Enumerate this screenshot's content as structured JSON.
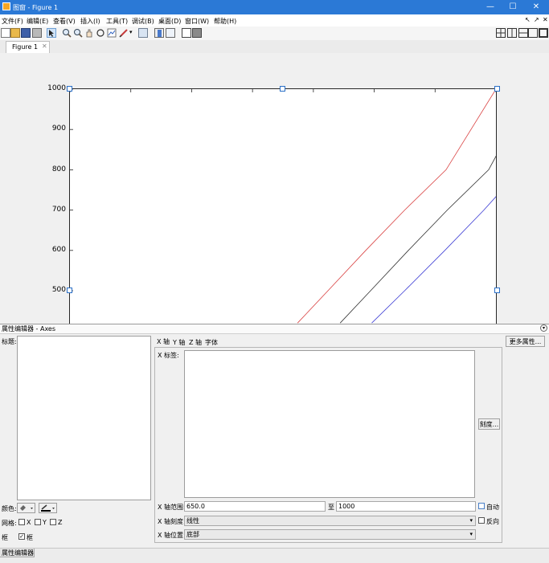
{
  "window": {
    "title": "图窗 - Figure 1"
  },
  "menu": [
    "文件(F)",
    "编辑(E)",
    "查看(V)",
    "插入(I)",
    "工具(T)",
    "调试(B)",
    "桌面(D)",
    "窗口(W)",
    "帮助(H)"
  ],
  "tabs": {
    "figure": "Figure 1"
  },
  "chart_data": {
    "type": "line",
    "yticks": [
      "1000",
      "900",
      "800",
      "700",
      "600",
      "500"
    ],
    "xlim": [
      650,
      1000
    ],
    "series": [
      {
        "color": "#d94040",
        "x": [
          837,
          862,
          893,
          925,
          959,
          1000
        ],
        "y": [
          420,
          500,
          600,
          700,
          800,
          1000
        ]
      },
      {
        "color": "#303030",
        "x": [
          872,
          897,
          928,
          960,
          994,
          1030
        ],
        "y": [
          420,
          500,
          600,
          700,
          800,
          1000
        ]
      },
      {
        "color": "#3b3bd4",
        "x": [
          898,
          925,
          958,
          990,
          1020,
          1057
        ],
        "y": [
          420,
          500,
          600,
          700,
          800,
          1000
        ]
      }
    ]
  },
  "property_editor": {
    "header": "属性编辑器 - Axes",
    "title_label": "标题:",
    "color_label": "颜色:",
    "grid_label": "网格:",
    "grid_x": "X",
    "grid_y": "Y",
    "grid_z": "Z",
    "box_label": "框",
    "box_checkbox_label": "框",
    "tabs": [
      "X 轴",
      "Y 轴",
      "Z 轴",
      "字体"
    ],
    "more_props": "更多属性...",
    "xlabel_label": "X 标签:",
    "ticks_button": "刻度...",
    "xlim_label": "X 轴范围:",
    "xlim_min": "650.0",
    "xlim_to": "至",
    "xlim_max": "1000",
    "auto_label": "自动",
    "xscale_label": "X 轴刻度:",
    "xscale_value": "线性",
    "reverse_label": "反向",
    "xloc_label": "X 轴位置:",
    "xloc_value": "底部"
  },
  "status": {
    "tab": "属性编辑器"
  },
  "icons": {
    "app": "matlab-figure-icon",
    "toolbar": [
      "new-icon",
      "open-icon",
      "save-icon",
      "print-icon",
      "pointer-icon",
      "zoom-in-icon",
      "zoom-out-icon",
      "pan-icon",
      "rotate-icon",
      "data-cursor-icon",
      "brush-icon",
      "link-icon",
      "colorbar-icon",
      "legend-icon",
      "hide-plot-tools-icon",
      "show-plot-tools-icon"
    ]
  }
}
